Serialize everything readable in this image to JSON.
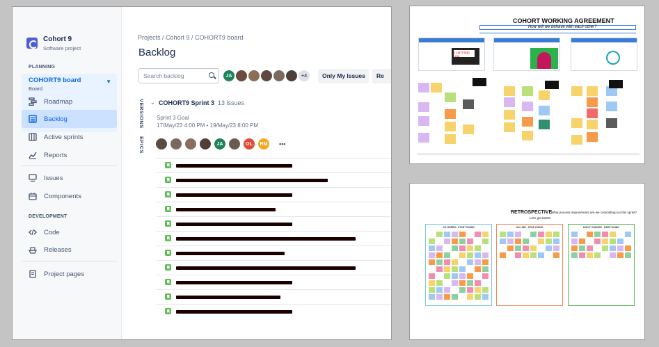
{
  "jira": {
    "project": {
      "name": "Cohort 9",
      "type": "Software project"
    },
    "sections": {
      "planning": "PLANNING",
      "development": "DEVELOPMENT"
    },
    "board": {
      "name": "COHORT9 board",
      "sub": "Board"
    },
    "nav": {
      "roadmap": "Roadmap",
      "backlog": "Backlog",
      "active_sprints": "Active sprints",
      "reports": "Reports",
      "issues": "Issues",
      "components": "Components",
      "code": "Code",
      "releases": "Releases",
      "project_pages": "Project pages"
    },
    "breadcrumb": "Projects  /  Cohort 9  /  COHORT9 board",
    "title": "Backlog",
    "search_placeholder": "Search backlog",
    "avatars_top": [
      {
        "initials": "JA",
        "color": "#1f845a"
      },
      {
        "initials": "",
        "color": "#6b4b3e"
      },
      {
        "initials": "",
        "color": "#8c6d5a"
      },
      {
        "initials": "",
        "color": "#5a4a42"
      },
      {
        "initials": "",
        "color": "#7a6a5c"
      },
      {
        "initials": "",
        "color": "#4e4038"
      },
      {
        "initials": "+4",
        "color": "#dfe1e6"
      }
    ],
    "buttons": {
      "only_my_issues": "Only My Issues",
      "recently": "Re"
    },
    "side_tabs": {
      "versions": "VERSIONS",
      "epics": "EPICS"
    },
    "sprint": {
      "name": "COHORT9 Sprint 3",
      "count": "13 issues",
      "goal": "Sprint 3 Goal",
      "dates": "17/May/23 4:00 PM  •  19/May/23 8:00 PM"
    },
    "avatars_sprint": [
      {
        "initials": "",
        "color": "#5a4a42"
      },
      {
        "initials": "",
        "color": "#7a6a5c"
      },
      {
        "initials": "",
        "color": "#8c6d5a"
      },
      {
        "initials": "",
        "color": "#4e4038"
      },
      {
        "initials": "JA",
        "color": "#1f845a"
      },
      {
        "initials": "",
        "color": "#6b5a4e"
      },
      {
        "initials": "OL",
        "color": "#e34935"
      },
      {
        "initials": "RM",
        "color": "#f5a623"
      }
    ],
    "more_label": "•••",
    "issue_redactions": [
      0.49,
      0.64,
      0.49,
      0.42,
      0.49,
      0.76,
      0.46,
      0.76,
      0.49,
      0.44,
      0.49
    ]
  },
  "working_agreement": {
    "title": "COHORT WORKING AGREEMENT",
    "subtitle": "How will we behave with each other?",
    "thumb_caption": "I can't stop you",
    "colors": [
      "#d9b8f2",
      "#f7d36b",
      "#f79a4a",
      "#b9e07a",
      "#9ec9f5",
      "#f26b6b",
      "#5b5b5b",
      "#2f8f6f"
    ]
  },
  "retrospective": {
    "title": "RETROSPECTIVE",
    "question": "What process improvement are we committing too this sprint?",
    "subtitle": "Let's get better!",
    "columns": [
      "GO GREEN - START DOING",
      "ON LINE - STOP DOING",
      "DON'T CHANGE - KEEP DOING"
    ],
    "column_colors": [
      "#7ec8e3",
      "#f28c5b",
      "#5bb55b"
    ]
  }
}
